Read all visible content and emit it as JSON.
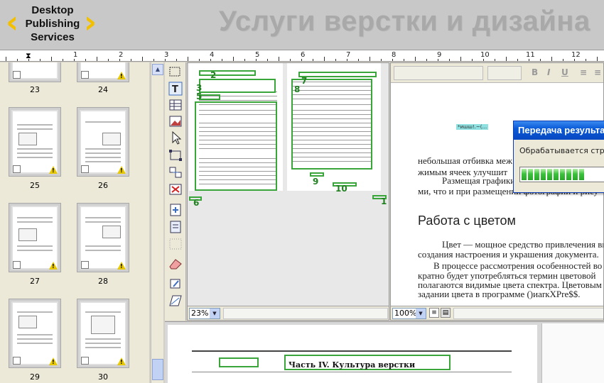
{
  "banner": {
    "logo_lines": [
      "Desktop",
      "Publishing",
      "Services"
    ],
    "title": "Услуги верстки и дизайна",
    "brand_color": "#f2c000"
  },
  "ruler": {
    "numbers": [
      "1",
      "2",
      "3",
      "4",
      "5",
      "6",
      "7",
      "8",
      "9",
      "10",
      "11",
      "12"
    ]
  },
  "thumbnails": {
    "pages": [
      "23",
      "24",
      "25",
      "26",
      "27",
      "28",
      "29",
      "30"
    ]
  },
  "layout_view": {
    "zoom": "23%",
    "frame_numbers": [
      "2",
      "3",
      "5",
      "7",
      "8",
      "9",
      "10",
      "6",
      "1"
    ],
    "frame_color": "#3aa53a"
  },
  "editor": {
    "zoom": "100%",
    "marker": "*ишш!.~(...",
    "lines": [
      "небольшая отбивка меж",
      "жимым ячеек улучшит",
      "Размещая графики в",
      "ми, что и при размещении фотографий и рису"
    ],
    "heading": "Работа с цветом",
    "paragraph": [
      "Цвет — мощное средство привлечения вн",
      "создания настроения и украшения документа.",
      "В процессе рассмотрения особенностей во",
      "кратно будет употребляться термин цветовой",
      "полагаются видимые цвета спектра. Цветовым",
      "задании цвета в программе ()иаrкХPre$$."
    ]
  },
  "dialog": {
    "title": "Передача результа",
    "message": "Обрабатывается стран",
    "progress": 0.78
  },
  "preview": {
    "heading": "Часть IV. Культура верстки"
  }
}
